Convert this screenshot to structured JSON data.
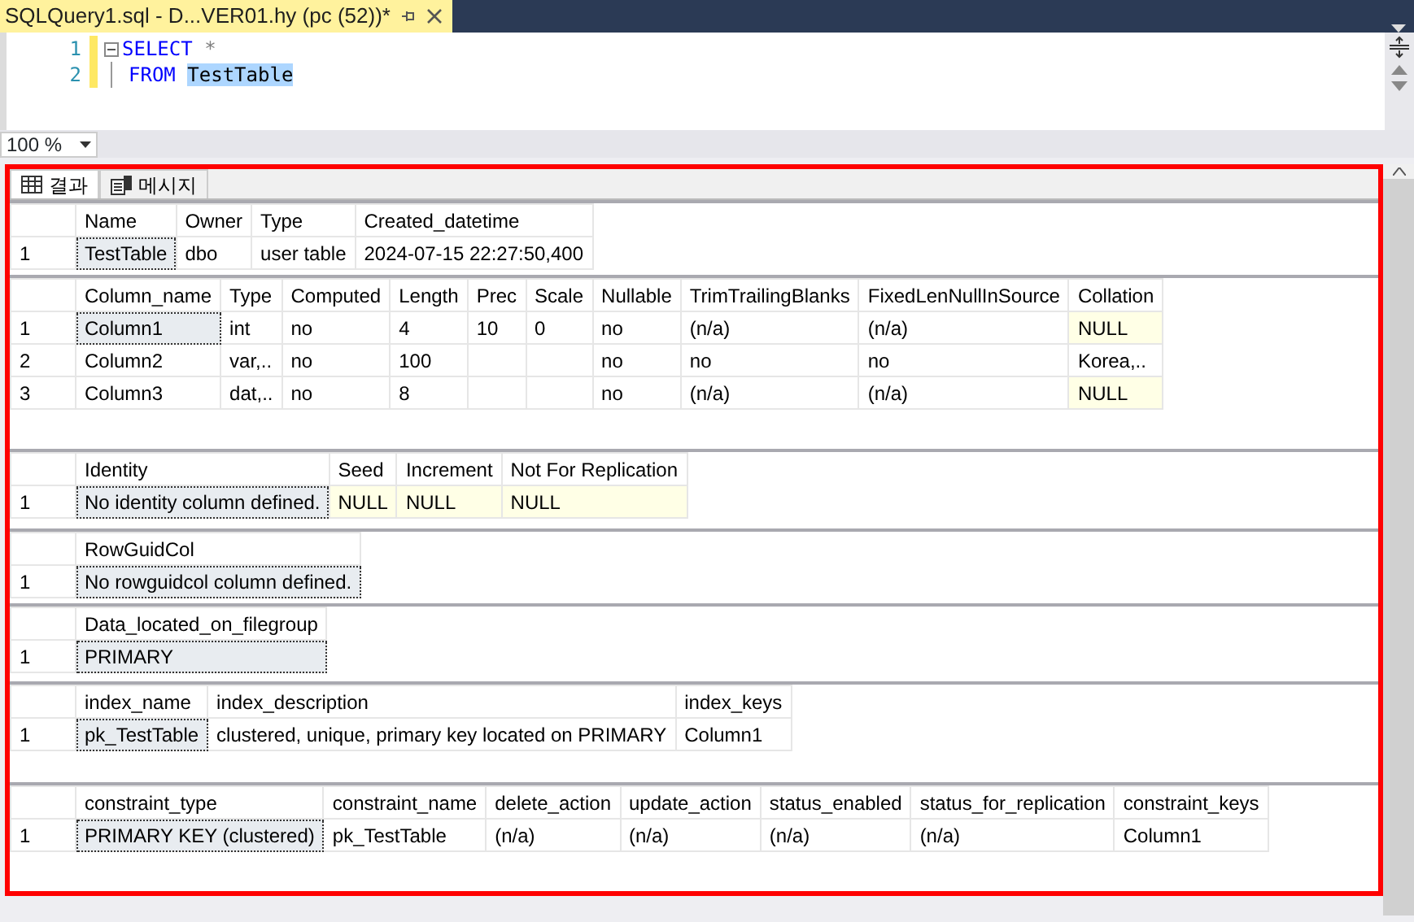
{
  "document_tab": {
    "title": "SQLQuery1.sql - D...VER01.hy (pc (52))*",
    "selected": true
  },
  "editor": {
    "lines": [
      {
        "number": "1",
        "tokens": [
          {
            "text": "SELECT",
            "kind": "keyword"
          },
          {
            "text": "*",
            "kind": "operator"
          }
        ]
      },
      {
        "number": "2",
        "tokens": [
          {
            "text": "FROM",
            "kind": "keyword"
          },
          {
            "text": "TestTable",
            "kind": "highlighted"
          }
        ]
      }
    ]
  },
  "zoom": {
    "value": "100 %"
  },
  "result_tabs": [
    {
      "label": "결과",
      "kind": "grid",
      "selected": true
    },
    {
      "label": "메시지",
      "kind": "messages",
      "selected": false
    }
  ],
  "grids": [
    {
      "columns": [
        "Name",
        "Owner",
        "Type",
        "Created_datetime"
      ],
      "rows": [
        {
          "number": "1",
          "cells": [
            {
              "text": "TestTable",
              "null": false,
              "selected": true
            },
            {
              "text": "dbo",
              "null": false,
              "selected": false
            },
            {
              "text": "user table",
              "null": false,
              "selected": false
            },
            {
              "text": "2024-07-15 22:27:50,400",
              "null": false,
              "selected": false
            }
          ]
        }
      ]
    },
    {
      "columns": [
        "Column_name",
        "Type",
        "Computed",
        "Length",
        "Prec",
        "Scale",
        "Nullable",
        "TrimTrailingBlanks",
        "FixedLenNullInSource",
        "Collation"
      ],
      "rows": [
        {
          "number": "1",
          "cells": [
            {
              "text": "Column1",
              "null": false,
              "selected": true
            },
            {
              "text": "int",
              "null": false,
              "selected": false
            },
            {
              "text": "no",
              "null": false,
              "selected": false
            },
            {
              "text": "4",
              "null": false,
              "selected": false
            },
            {
              "text": "10",
              "null": false,
              "selected": false
            },
            {
              "text": "0",
              "null": false,
              "selected": false
            },
            {
              "text": "no",
              "null": false,
              "selected": false
            },
            {
              "text": "(n/a)",
              "null": false,
              "selected": false
            },
            {
              "text": "(n/a)",
              "null": false,
              "selected": false
            },
            {
              "text": "NULL",
              "null": true,
              "selected": false
            }
          ]
        },
        {
          "number": "2",
          "cells": [
            {
              "text": "Column2",
              "null": false,
              "selected": false
            },
            {
              "text": "var,..",
              "null": false,
              "selected": false
            },
            {
              "text": "no",
              "null": false,
              "selected": false
            },
            {
              "text": "100",
              "null": false,
              "selected": false
            },
            {
              "null": false,
              "selected": false
            },
            {
              "null": false,
              "selected": false
            },
            {
              "text": "no",
              "null": false,
              "selected": false
            },
            {
              "text": "no",
              "null": false,
              "selected": false
            },
            {
              "text": "no",
              "null": false,
              "selected": false
            },
            {
              "text": "Korea,..",
              "null": false,
              "selected": false
            }
          ]
        },
        {
          "number": "3",
          "cells": [
            {
              "text": "Column3",
              "null": false,
              "selected": false
            },
            {
              "text": "dat,..",
              "null": false,
              "selected": false
            },
            {
              "text": "no",
              "null": false,
              "selected": false
            },
            {
              "text": "8",
              "null": false,
              "selected": false
            },
            {
              "null": false,
              "selected": false
            },
            {
              "null": false,
              "selected": false
            },
            {
              "text": "no",
              "null": false,
              "selected": false
            },
            {
              "text": "(n/a)",
              "null": false,
              "selected": false
            },
            {
              "text": "(n/a)",
              "null": false,
              "selected": false
            },
            {
              "text": "NULL",
              "null": true,
              "selected": false
            }
          ]
        }
      ]
    },
    {
      "columns": [
        "Identity",
        "Seed",
        "Increment",
        "Not For Replication"
      ],
      "rows": [
        {
          "number": "1",
          "cells": [
            {
              "text": "No identity column defined.",
              "null": false,
              "selected": true
            },
            {
              "text": "NULL",
              "null": true,
              "selected": false
            },
            {
              "text": "NULL",
              "null": true,
              "selected": false
            },
            {
              "text": "NULL",
              "null": true,
              "selected": false
            }
          ]
        }
      ]
    },
    {
      "columns": [
        "RowGuidCol"
      ],
      "rows": [
        {
          "number": "1",
          "cells": [
            {
              "text": "No rowguidcol column defined.",
              "null": false,
              "selected": true
            }
          ]
        }
      ]
    },
    {
      "columns": [
        "Data_located_on_filegroup"
      ],
      "rows": [
        {
          "number": "1",
          "cells": [
            {
              "text": "PRIMARY",
              "null": false,
              "selected": true
            }
          ]
        }
      ]
    },
    {
      "columns": [
        "index_name",
        "index_description",
        "index_keys"
      ],
      "rows": [
        {
          "number": "1",
          "cells": [
            {
              "text": "pk_TestTable",
              "null": false,
              "selected": true
            },
            {
              "text": "clustered, unique, primary key located on PRIMARY",
              "null": false,
              "selected": false
            },
            {
              "text": "Column1",
              "null": false,
              "selected": false
            }
          ]
        }
      ]
    },
    {
      "columns": [
        "constraint_type",
        "constraint_name",
        "delete_action",
        "update_action",
        "status_enabled",
        "status_for_replication",
        "constraint_keys"
      ],
      "rows": [
        {
          "number": "1",
          "cells": [
            {
              "text": "PRIMARY KEY (clustered)",
              "null": false,
              "selected": true
            },
            {
              "text": "pk_TestTable",
              "null": false,
              "selected": false
            },
            {
              "text": "(n/a)",
              "null": false,
              "selected": false
            },
            {
              "text": "(n/a)",
              "null": false,
              "selected": false
            },
            {
              "text": "(n/a)",
              "null": false,
              "selected": false
            },
            {
              "text": "(n/a)",
              "null": false,
              "selected": false
            },
            {
              "text": "Column1",
              "null": false,
              "selected": false
            }
          ]
        }
      ]
    }
  ]
}
